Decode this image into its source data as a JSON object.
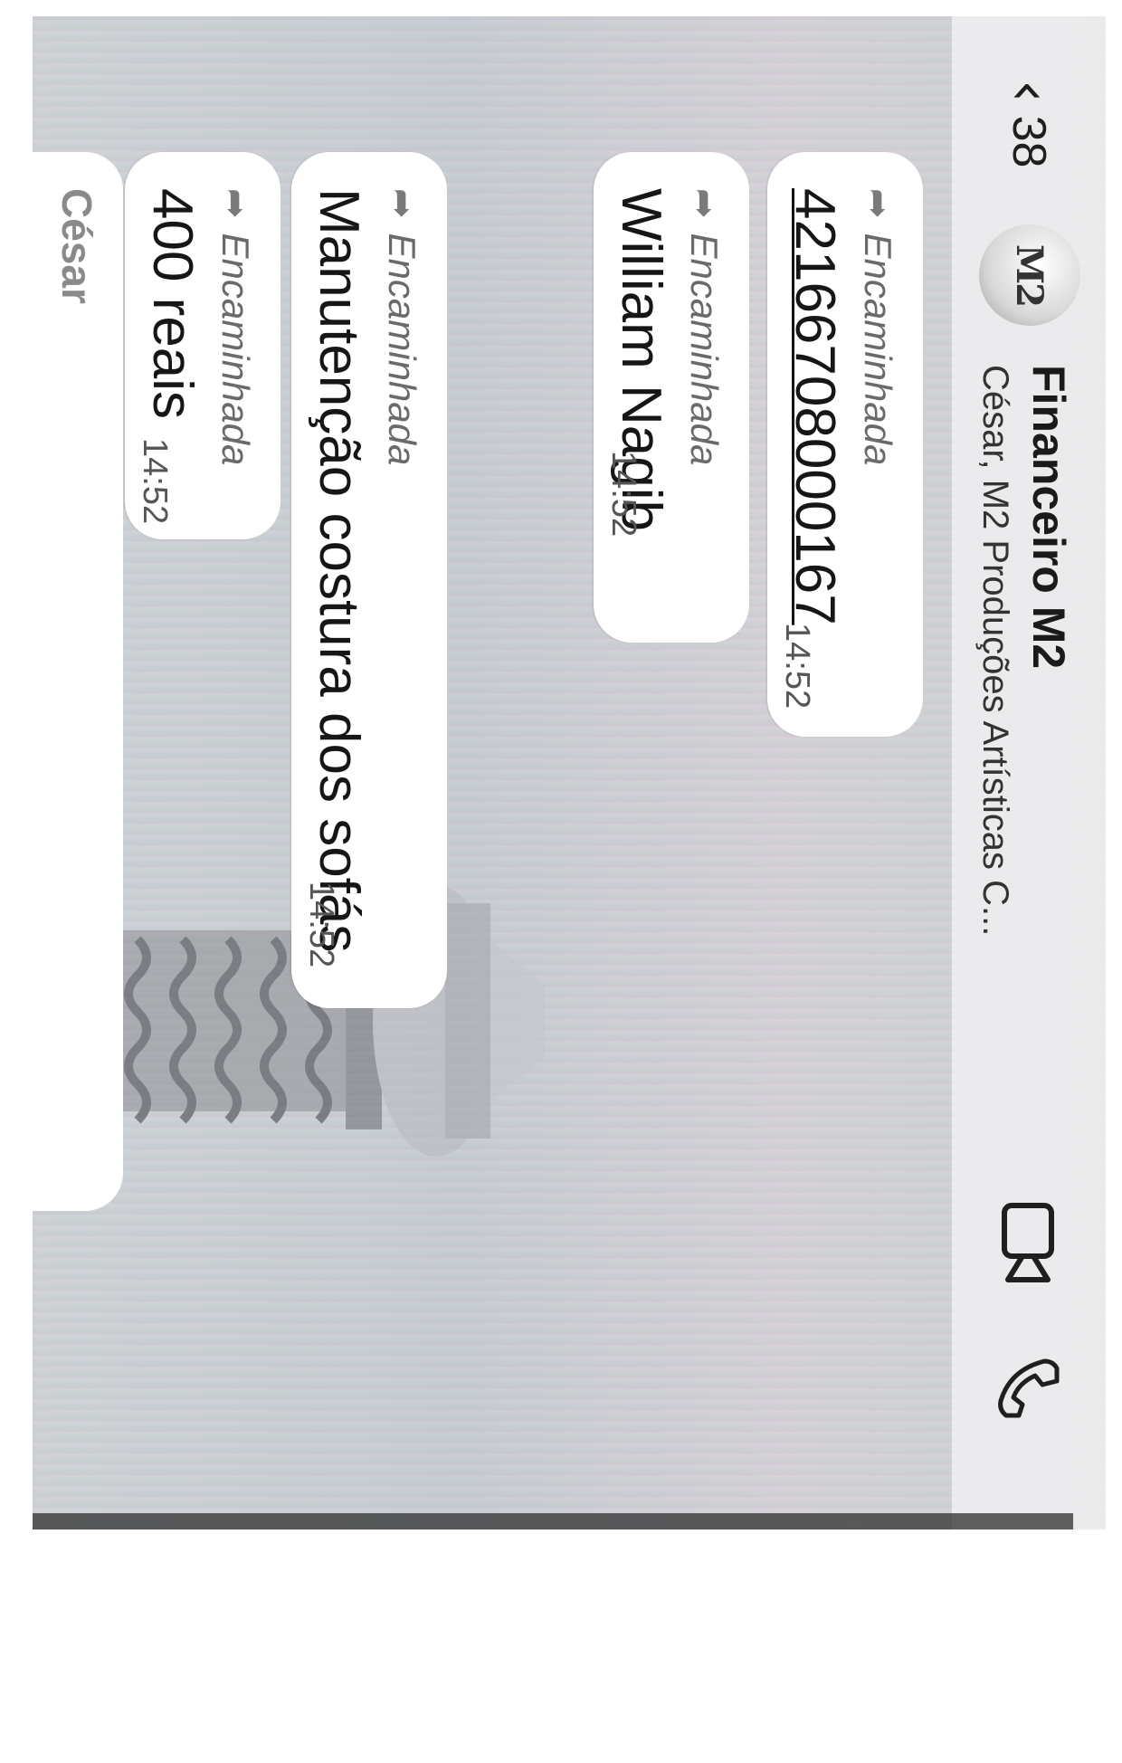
{
  "header": {
    "back_count": "38",
    "avatar_text": "M2",
    "title": "Financeiro M2",
    "subtitle": "César, M2 Produções Artísticas C...",
    "video_icon": "video-camera-icon",
    "call_icon": "phone-icon"
  },
  "messages": [
    {
      "forwarded_label": "Encaminhada",
      "text": "42166708000167",
      "time": "14:52",
      "is_link": true
    },
    {
      "forwarded_label": "Encaminhada",
      "text": "William Nagib",
      "time": "14:52",
      "is_link": false
    },
    {
      "forwarded_label": "Encaminhada",
      "text": "Manutenção costura dos sofás",
      "time": "14:52",
      "is_link": false
    },
    {
      "forwarded_label": "Encaminhada",
      "text": "400 reais",
      "time": "14:52",
      "is_link": false
    }
  ],
  "next_sender": {
    "name": "César"
  }
}
